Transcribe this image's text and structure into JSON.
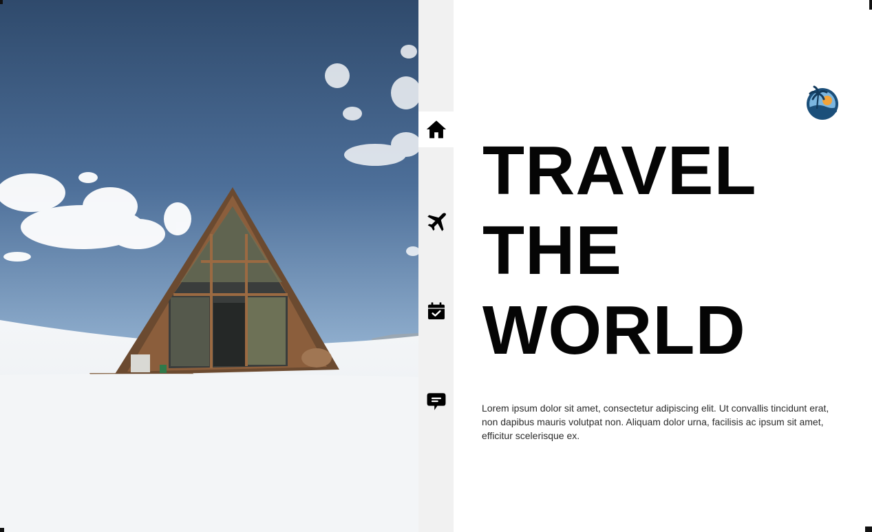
{
  "nav": {
    "items": [
      {
        "name": "home",
        "icon": "home-icon",
        "active": true
      },
      {
        "name": "flights",
        "icon": "airplane-icon",
        "active": false
      },
      {
        "name": "bookings",
        "icon": "calendar-check-icon",
        "active": false
      },
      {
        "name": "messages",
        "icon": "chat-icon",
        "active": false
      }
    ]
  },
  "hero": {
    "line1": "TRAVEL",
    "line2": "THE",
    "line3": "WORLD",
    "body": "Lorem ipsum dolor sit amet, consectetur adipiscing elit. Ut convallis tincidunt erat, non dapibus mauris volutpat non. Aliquam dolor urna, facilisis ac ipsum sit amet, efficitur scelerisque ex."
  },
  "colors": {
    "accent": "#050505",
    "rail": "#f1f1f1",
    "logo_primary": "#1b4f7a",
    "logo_sun": "#f2a33a"
  }
}
